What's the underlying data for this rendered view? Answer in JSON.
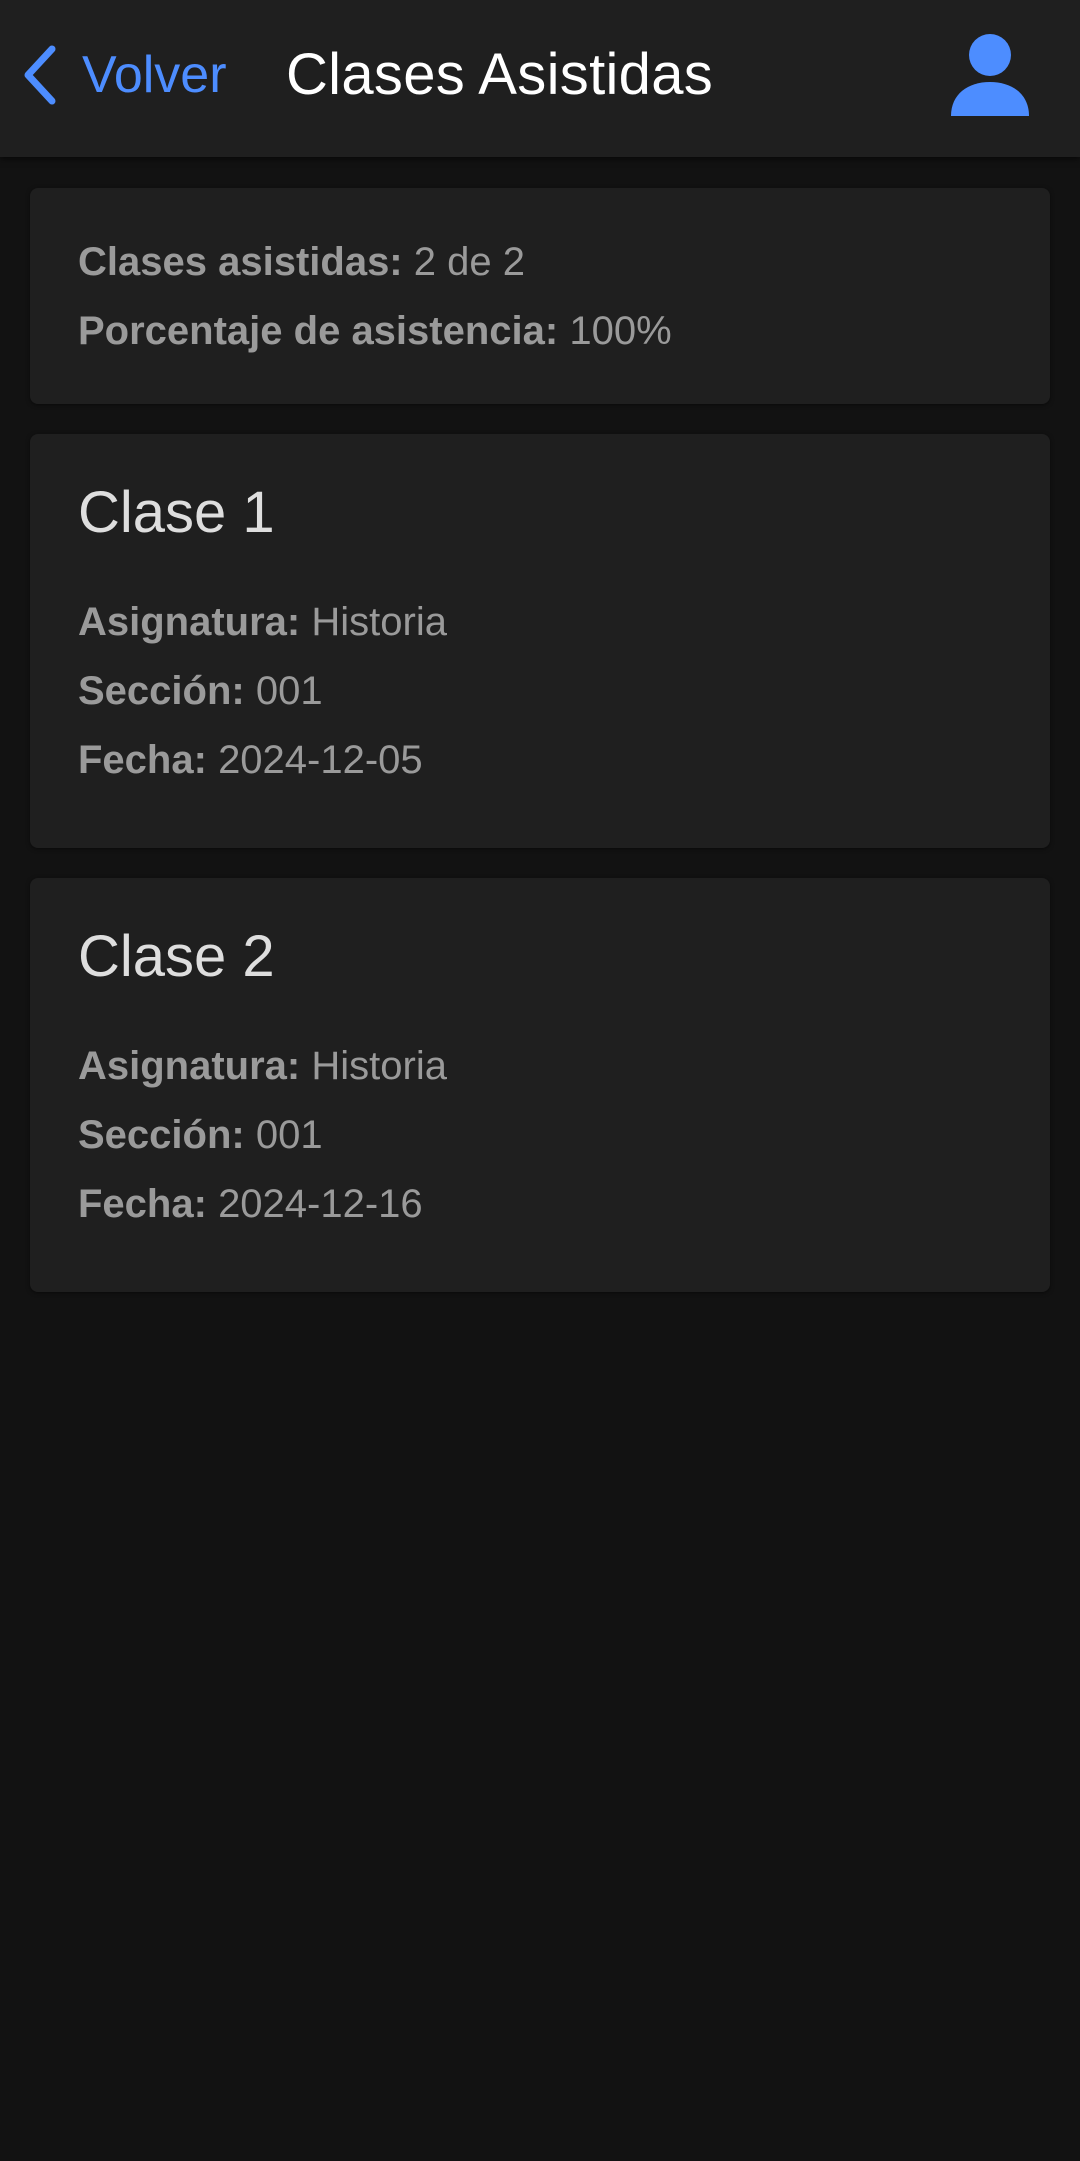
{
  "header": {
    "back_label": "Volver",
    "title": "Clases Asistidas",
    "back_icon": "chevron-left-icon",
    "profile_icon": "person-icon",
    "accent_color": "#4d8dff"
  },
  "summary": {
    "attended_label": "Clases asistidas:",
    "attended_value": "2 de 2",
    "percentage_label": "Porcentaje de asistencia:",
    "percentage_value": "100%"
  },
  "classes": [
    {
      "title": "Clase 1",
      "subject_label": "Asignatura:",
      "subject": "Historia",
      "section_label": "Sección:",
      "section": "001",
      "date_label": "Fecha:",
      "date": "2024-12-05"
    },
    {
      "title": "Clase 2",
      "subject_label": "Asignatura:",
      "subject": "Historia",
      "section_label": "Sección:",
      "section": "001",
      "date_label": "Fecha:",
      "date": "2024-12-16"
    }
  ]
}
